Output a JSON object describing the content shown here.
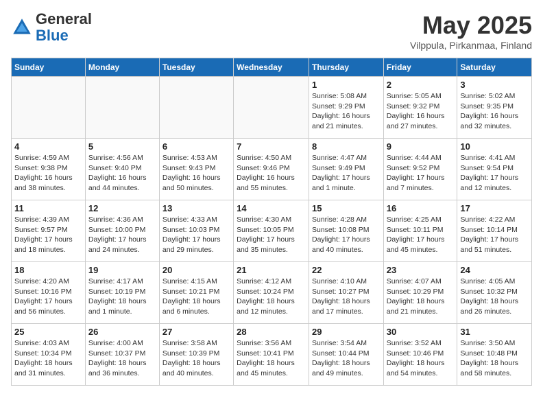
{
  "header": {
    "logo_line1": "General",
    "logo_line2": "Blue",
    "month_title": "May 2025",
    "subtitle": "Vilppula, Pirkanmaa, Finland"
  },
  "days_of_week": [
    "Sunday",
    "Monday",
    "Tuesday",
    "Wednesday",
    "Thursday",
    "Friday",
    "Saturday"
  ],
  "weeks": [
    [
      {
        "day": "",
        "info": ""
      },
      {
        "day": "",
        "info": ""
      },
      {
        "day": "",
        "info": ""
      },
      {
        "day": "",
        "info": ""
      },
      {
        "day": "1",
        "info": "Sunrise: 5:08 AM\nSunset: 9:29 PM\nDaylight: 16 hours and 21 minutes."
      },
      {
        "day": "2",
        "info": "Sunrise: 5:05 AM\nSunset: 9:32 PM\nDaylight: 16 hours and 27 minutes."
      },
      {
        "day": "3",
        "info": "Sunrise: 5:02 AM\nSunset: 9:35 PM\nDaylight: 16 hours and 32 minutes."
      }
    ],
    [
      {
        "day": "4",
        "info": "Sunrise: 4:59 AM\nSunset: 9:38 PM\nDaylight: 16 hours and 38 minutes."
      },
      {
        "day": "5",
        "info": "Sunrise: 4:56 AM\nSunset: 9:40 PM\nDaylight: 16 hours and 44 minutes."
      },
      {
        "day": "6",
        "info": "Sunrise: 4:53 AM\nSunset: 9:43 PM\nDaylight: 16 hours and 50 minutes."
      },
      {
        "day": "7",
        "info": "Sunrise: 4:50 AM\nSunset: 9:46 PM\nDaylight: 16 hours and 55 minutes."
      },
      {
        "day": "8",
        "info": "Sunrise: 4:47 AM\nSunset: 9:49 PM\nDaylight: 17 hours and 1 minute."
      },
      {
        "day": "9",
        "info": "Sunrise: 4:44 AM\nSunset: 9:52 PM\nDaylight: 17 hours and 7 minutes."
      },
      {
        "day": "10",
        "info": "Sunrise: 4:41 AM\nSunset: 9:54 PM\nDaylight: 17 hours and 12 minutes."
      }
    ],
    [
      {
        "day": "11",
        "info": "Sunrise: 4:39 AM\nSunset: 9:57 PM\nDaylight: 17 hours and 18 minutes."
      },
      {
        "day": "12",
        "info": "Sunrise: 4:36 AM\nSunset: 10:00 PM\nDaylight: 17 hours and 24 minutes."
      },
      {
        "day": "13",
        "info": "Sunrise: 4:33 AM\nSunset: 10:03 PM\nDaylight: 17 hours and 29 minutes."
      },
      {
        "day": "14",
        "info": "Sunrise: 4:30 AM\nSunset: 10:05 PM\nDaylight: 17 hours and 35 minutes."
      },
      {
        "day": "15",
        "info": "Sunrise: 4:28 AM\nSunset: 10:08 PM\nDaylight: 17 hours and 40 minutes."
      },
      {
        "day": "16",
        "info": "Sunrise: 4:25 AM\nSunset: 10:11 PM\nDaylight: 17 hours and 45 minutes."
      },
      {
        "day": "17",
        "info": "Sunrise: 4:22 AM\nSunset: 10:14 PM\nDaylight: 17 hours and 51 minutes."
      }
    ],
    [
      {
        "day": "18",
        "info": "Sunrise: 4:20 AM\nSunset: 10:16 PM\nDaylight: 17 hours and 56 minutes."
      },
      {
        "day": "19",
        "info": "Sunrise: 4:17 AM\nSunset: 10:19 PM\nDaylight: 18 hours and 1 minute."
      },
      {
        "day": "20",
        "info": "Sunrise: 4:15 AM\nSunset: 10:21 PM\nDaylight: 18 hours and 6 minutes."
      },
      {
        "day": "21",
        "info": "Sunrise: 4:12 AM\nSunset: 10:24 PM\nDaylight: 18 hours and 12 minutes."
      },
      {
        "day": "22",
        "info": "Sunrise: 4:10 AM\nSunset: 10:27 PM\nDaylight: 18 hours and 17 minutes."
      },
      {
        "day": "23",
        "info": "Sunrise: 4:07 AM\nSunset: 10:29 PM\nDaylight: 18 hours and 21 minutes."
      },
      {
        "day": "24",
        "info": "Sunrise: 4:05 AM\nSunset: 10:32 PM\nDaylight: 18 hours and 26 minutes."
      }
    ],
    [
      {
        "day": "25",
        "info": "Sunrise: 4:03 AM\nSunset: 10:34 PM\nDaylight: 18 hours and 31 minutes."
      },
      {
        "day": "26",
        "info": "Sunrise: 4:00 AM\nSunset: 10:37 PM\nDaylight: 18 hours and 36 minutes."
      },
      {
        "day": "27",
        "info": "Sunrise: 3:58 AM\nSunset: 10:39 PM\nDaylight: 18 hours and 40 minutes."
      },
      {
        "day": "28",
        "info": "Sunrise: 3:56 AM\nSunset: 10:41 PM\nDaylight: 18 hours and 45 minutes."
      },
      {
        "day": "29",
        "info": "Sunrise: 3:54 AM\nSunset: 10:44 PM\nDaylight: 18 hours and 49 minutes."
      },
      {
        "day": "30",
        "info": "Sunrise: 3:52 AM\nSunset: 10:46 PM\nDaylight: 18 hours and 54 minutes."
      },
      {
        "day": "31",
        "info": "Sunrise: 3:50 AM\nSunset: 10:48 PM\nDaylight: 18 hours and 58 minutes."
      }
    ]
  ]
}
